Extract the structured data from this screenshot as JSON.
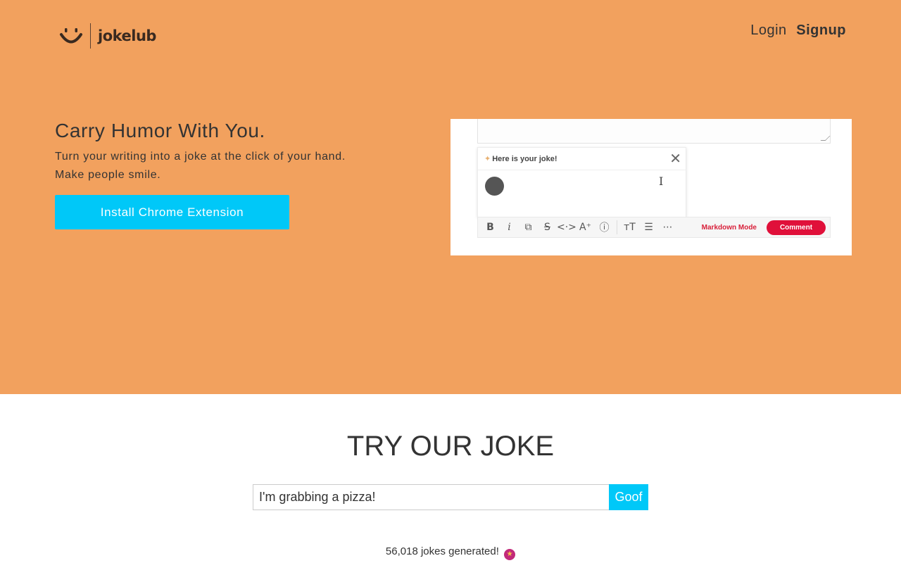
{
  "brand": {
    "name": "jokelub",
    "logo_icon": "smiley-face-icon"
  },
  "nav": {
    "login": "Login",
    "signup": "Signup"
  },
  "hero": {
    "title": "Carry Humor With You.",
    "subtitle_line1": "Turn your writing into a joke at the click of your hand.",
    "subtitle_line2": "Make people smile.",
    "cta_label": "Install Chrome Extension"
  },
  "preview": {
    "popup_title": "Here is your joke!",
    "toolbar": {
      "bold": "B",
      "italic": "i",
      "link": "⧉",
      "strike": "S",
      "code": "<·>",
      "text_size": "A⁺",
      "info": "ⓘ",
      "heading": "ᴛT",
      "list": "☰",
      "more": "⋯",
      "markdown_mode": "Markdown Mode",
      "comment": "Comment"
    }
  },
  "try": {
    "title": "TRY OUR JOKE",
    "input_value": "I'm grabbing a pizza!",
    "button_label": "Goof",
    "counter_text": "56,018 jokes generated!",
    "counter_emoji": "star-struck-emoji-icon"
  },
  "colors": {
    "hero_bg": "#f2a15e",
    "accent": "#00c8f8",
    "comment_red": "#e0103a"
  }
}
